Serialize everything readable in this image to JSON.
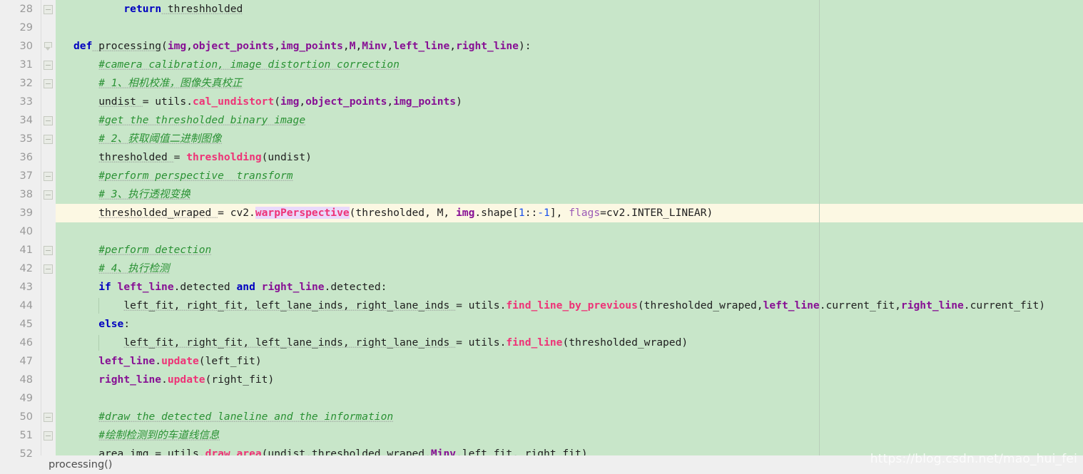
{
  "editor": {
    "first_line_number": 28,
    "current_line_number": 39,
    "line_height": 26,
    "colors": {
      "code_background": "#c8e6c9",
      "gutter_background": "#efefef",
      "current_line_background": "#fcf8e3",
      "line_number": "#999999",
      "keyword": "#0000c0",
      "function": "#ee3377",
      "parameter": "#871094",
      "comment": "#2a9134",
      "number": "#1750eb",
      "keyword_argument": "#9b59b6",
      "identifier_highlight": "#ead9fb",
      "margin_guide": "#b9cdba",
      "indent_guide": "#aecdaf"
    }
  },
  "lines": [
    {
      "number": "28",
      "fold": "open-square",
      "indent": 8,
      "current": false,
      "tokens": [
        {
          "t": "return",
          "c": "kw"
        },
        {
          "t": " threshholded",
          "c": "plain wavy"
        }
      ]
    },
    {
      "number": "29",
      "fold": "none",
      "indent": 0,
      "current": false,
      "tokens": []
    },
    {
      "number": "30",
      "fold": "triangle",
      "indent": 0,
      "current": false,
      "tokens": [
        {
          "t": "def",
          "c": "kw"
        },
        {
          "t": " processing",
          "c": "plain wavy"
        },
        {
          "t": "(",
          "c": "plain"
        },
        {
          "t": "img",
          "c": "par"
        },
        {
          "t": ",",
          "c": "plain"
        },
        {
          "t": "object_points",
          "c": "par"
        },
        {
          "t": ",",
          "c": "plain"
        },
        {
          "t": "img_points",
          "c": "par"
        },
        {
          "t": ",",
          "c": "plain"
        },
        {
          "t": "M",
          "c": "par"
        },
        {
          "t": ",",
          "c": "plain"
        },
        {
          "t": "Minv",
          "c": "par"
        },
        {
          "t": ",",
          "c": "plain"
        },
        {
          "t": "left_line",
          "c": "par"
        },
        {
          "t": ",",
          "c": "plain"
        },
        {
          "t": "right_line",
          "c": "par"
        },
        {
          "t": "):",
          "c": "plain"
        }
      ]
    },
    {
      "number": "31",
      "fold": "open-square",
      "indent": 4,
      "current": false,
      "tokens": [
        {
          "t": "#camera calibration, image distortion correction",
          "c": "cmt wavy"
        }
      ]
    },
    {
      "number": "32",
      "fold": "open-square",
      "indent": 4,
      "current": false,
      "tokens": [
        {
          "t": "# 1、相机校准，图像失真校正",
          "c": "cmt wavy"
        }
      ]
    },
    {
      "number": "33",
      "fold": "none",
      "indent": 4,
      "current": false,
      "tokens": [
        {
          "t": "undist ",
          "c": "plain wavy"
        },
        {
          "t": "= utils.",
          "c": "plain"
        },
        {
          "t": "cal_undistort",
          "c": "fn"
        },
        {
          "t": "(",
          "c": "plain"
        },
        {
          "t": "img",
          "c": "par"
        },
        {
          "t": ",",
          "c": "plain"
        },
        {
          "t": "object_points",
          "c": "par"
        },
        {
          "t": ",",
          "c": "plain"
        },
        {
          "t": "img_points",
          "c": "par"
        },
        {
          "t": ")",
          "c": "plain"
        }
      ]
    },
    {
      "number": "34",
      "fold": "open-square",
      "indent": 4,
      "current": false,
      "tokens": [
        {
          "t": "#get the thresholded binary image",
          "c": "cmt wavy"
        }
      ]
    },
    {
      "number": "35",
      "fold": "open-square",
      "indent": 4,
      "current": false,
      "tokens": [
        {
          "t": "# 2、获取阈值二进制图像",
          "c": "cmt wavy"
        }
      ]
    },
    {
      "number": "36",
      "fold": "none",
      "indent": 4,
      "current": false,
      "tokens": [
        {
          "t": "thresholded ",
          "c": "plain wavy"
        },
        {
          "t": "= ",
          "c": "plain"
        },
        {
          "t": "thresholding",
          "c": "fn"
        },
        {
          "t": "(undist)",
          "c": "plain"
        }
      ]
    },
    {
      "number": "37",
      "fold": "open-square",
      "indent": 4,
      "current": false,
      "tokens": [
        {
          "t": "#perform perspective  transform",
          "c": "cmt wavy"
        }
      ]
    },
    {
      "number": "38",
      "fold": "open-square",
      "indent": 4,
      "current": false,
      "tokens": [
        {
          "t": "# 3、执行透视变换",
          "c": "cmt wavy"
        }
      ]
    },
    {
      "number": "39",
      "fold": "none",
      "indent": 4,
      "current": true,
      "tokens": [
        {
          "t": "thresholded_wraped ",
          "c": "plain wavy"
        },
        {
          "t": "= cv2.",
          "c": "plain"
        },
        {
          "t": "warpPerspective",
          "c": "fn hl"
        },
        {
          "t": "(thresholded, M, ",
          "c": "plain"
        },
        {
          "t": "img",
          "c": "par"
        },
        {
          "t": ".shape[",
          "c": "plain"
        },
        {
          "t": "1",
          "c": "num"
        },
        {
          "t": "::",
          "c": "plain"
        },
        {
          "t": "-1",
          "c": "num"
        },
        {
          "t": "], ",
          "c": "plain"
        },
        {
          "t": "flags",
          "c": "kwarg"
        },
        {
          "t": "=cv2.INTER_LINEAR)",
          "c": "plain"
        }
      ]
    },
    {
      "number": "40",
      "fold": "none",
      "indent": 0,
      "current": false,
      "tokens": []
    },
    {
      "number": "41",
      "fold": "open-square",
      "indent": 4,
      "current": false,
      "tokens": [
        {
          "t": "#perform detection",
          "c": "cmt wavy"
        }
      ]
    },
    {
      "number": "42",
      "fold": "open-square",
      "indent": 4,
      "current": false,
      "tokens": [
        {
          "t": "# 4、执行检测",
          "c": "cmt wavy"
        }
      ]
    },
    {
      "number": "43",
      "fold": "none",
      "indent": 4,
      "current": false,
      "tokens": [
        {
          "t": "if ",
          "c": "kw"
        },
        {
          "t": "left_line",
          "c": "par"
        },
        {
          "t": ".detected ",
          "c": "plain"
        },
        {
          "t": "and ",
          "c": "kw"
        },
        {
          "t": "right_line",
          "c": "par"
        },
        {
          "t": ".detected:",
          "c": "plain"
        }
      ]
    },
    {
      "number": "44",
      "fold": "none",
      "indent": 8,
      "current": false,
      "tokens": [
        {
          "t": "left_fit, right_fit, left_lane_inds, right_lane_inds ",
          "c": "plain wavy"
        },
        {
          "t": "= utils.",
          "c": "plain"
        },
        {
          "t": "find_line_by_previous",
          "c": "fn"
        },
        {
          "t": "(thresholded_wraped,",
          "c": "plain"
        },
        {
          "t": "left_line",
          "c": "par"
        },
        {
          "t": ".current_fit,",
          "c": "plain"
        },
        {
          "t": "right_line",
          "c": "par"
        },
        {
          "t": ".current_fit)",
          "c": "plain"
        }
      ]
    },
    {
      "number": "45",
      "fold": "none",
      "indent": 4,
      "current": false,
      "tokens": [
        {
          "t": "else",
          "c": "kw"
        },
        {
          "t": ":",
          "c": "plain"
        }
      ]
    },
    {
      "number": "46",
      "fold": "none",
      "indent": 8,
      "current": false,
      "tokens": [
        {
          "t": "left_fit, right_fit, left_lane_inds, right_lane_inds ",
          "c": "plain wavy"
        },
        {
          "t": "= utils.",
          "c": "plain"
        },
        {
          "t": "find_line",
          "c": "fn"
        },
        {
          "t": "(thresholded_wraped)",
          "c": "plain"
        }
      ]
    },
    {
      "number": "47",
      "fold": "none",
      "indent": 4,
      "current": false,
      "tokens": [
        {
          "t": "left_line",
          "c": "par"
        },
        {
          "t": ".",
          "c": "plain"
        },
        {
          "t": "update",
          "c": "fn"
        },
        {
          "t": "(left_fit)",
          "c": "plain"
        }
      ]
    },
    {
      "number": "48",
      "fold": "none",
      "indent": 4,
      "current": false,
      "tokens": [
        {
          "t": "right_line",
          "c": "par"
        },
        {
          "t": ".",
          "c": "plain"
        },
        {
          "t": "update",
          "c": "fn"
        },
        {
          "t": "(right_fit)",
          "c": "plain"
        }
      ]
    },
    {
      "number": "49",
      "fold": "none",
      "indent": 0,
      "current": false,
      "tokens": []
    },
    {
      "number": "50",
      "fold": "open-square",
      "indent": 4,
      "current": false,
      "tokens": [
        {
          "t": "#draw the detected laneline and the information",
          "c": "cmt wavy"
        }
      ]
    },
    {
      "number": "51",
      "fold": "open-square",
      "indent": 4,
      "current": false,
      "tokens": [
        {
          "t": "#绘制检测到的车道线信息",
          "c": "cmt wavy"
        }
      ]
    },
    {
      "number": "52",
      "fold": "none",
      "indent": 4,
      "current": false,
      "tokens": [
        {
          "t": "area_img ",
          "c": "plain wavy"
        },
        {
          "t": "= utils.",
          "c": "plain"
        },
        {
          "t": "draw_area",
          "c": "fn"
        },
        {
          "t": "(undist,thresholded_wraped,",
          "c": "plain"
        },
        {
          "t": "Minv",
          "c": "par"
        },
        {
          "t": ",left_fit, right_fit)",
          "c": "plain"
        }
      ]
    }
  ],
  "indent_guides": [
    {
      "line_index": 16,
      "indent": 8
    },
    {
      "line_index": 18,
      "indent": 8
    }
  ],
  "statusbar": {
    "breadcrumb": "processing()"
  },
  "watermark": {
    "text": "https://blog.csdn.net/mao_hui_fei"
  }
}
